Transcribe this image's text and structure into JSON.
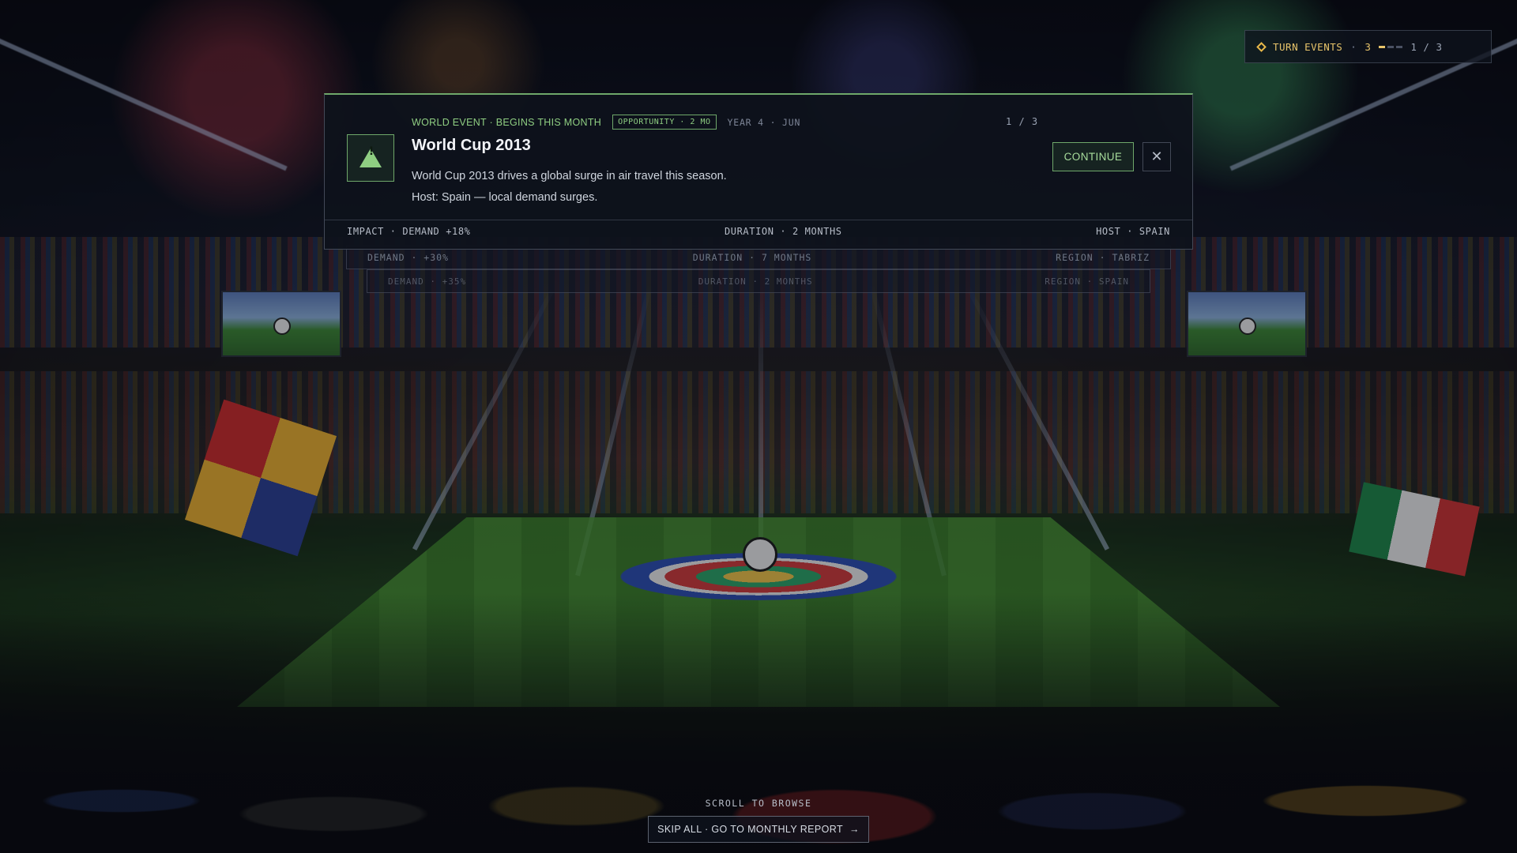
{
  "hud": {
    "turn_label": "TURN EVENTS",
    "turn_count": "3",
    "separator": "·",
    "pips_total": 3,
    "pips_active": 1,
    "page": "1 / 3",
    "accent_color": "#e8c46a"
  },
  "event": {
    "kicker": "WORLD EVENT · BEGINS THIS MONTH",
    "badge": "OPPORTUNITY · 2 MO",
    "date": "YEAR 4 · JUN",
    "page": "1 / 3",
    "title": "World Cup 2013",
    "description": "World Cup 2013 drives a global surge in air travel this season.",
    "host_note": "Host: Spain — local demand surges.",
    "icon": "warning-triangle-icon",
    "accent_color": "#8fce82",
    "continue_label": "CONTINUE",
    "close_icon": "close-icon",
    "footer": {
      "impact": "IMPACT · DEMAND +18%",
      "duration": "DURATION · 2 MONTHS",
      "host": "HOST · SPAIN"
    }
  },
  "stack": [
    {
      "demand": "DEMAND · +30%",
      "duration": "DURATION · 7 MONTHS",
      "region": "REGION · TABRIZ"
    },
    {
      "demand": "DEMAND · +35%",
      "duration": "DURATION · 2 MONTHS",
      "region": "REGION · SPAIN"
    }
  ],
  "footer": {
    "scroll_hint": "SCROLL TO BROWSE",
    "skip_label": "SKIP ALL · GO TO MONTHLY REPORT",
    "skip_arrow": "→"
  }
}
